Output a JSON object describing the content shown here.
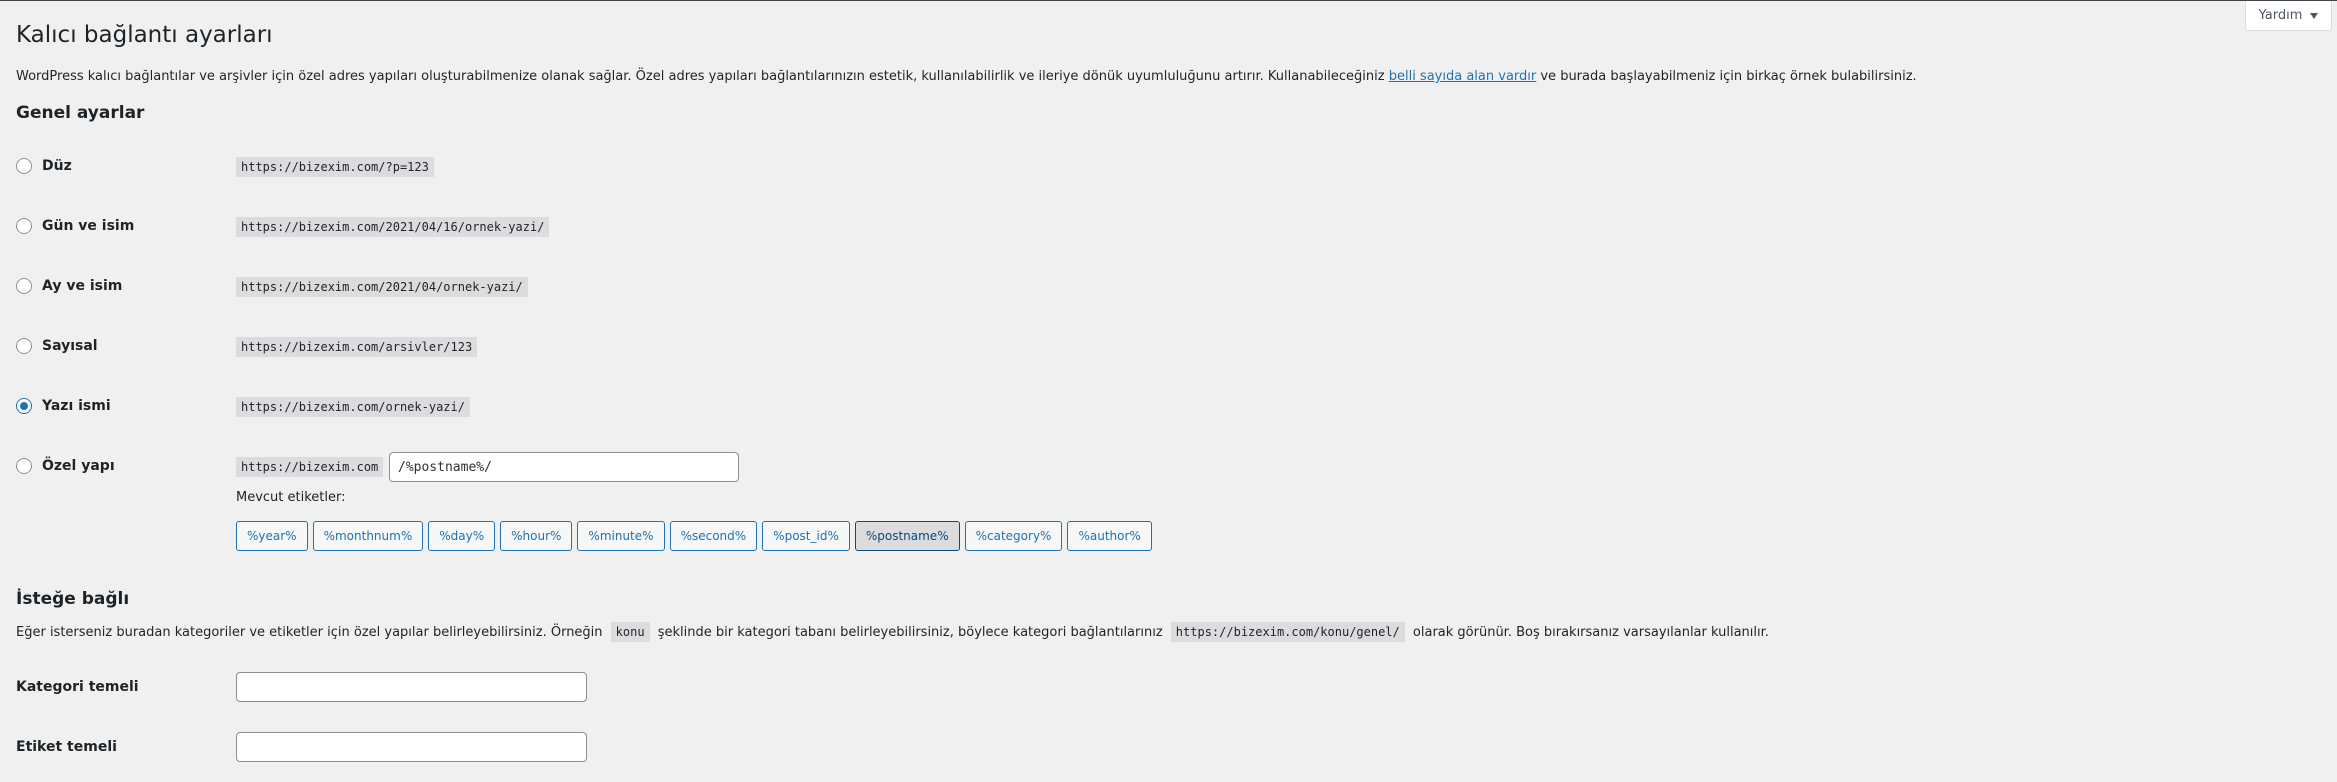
{
  "help": {
    "label": "Yardım"
  },
  "page": {
    "title": "Kalıcı bağlantı ayarları",
    "description_before": "WordPress kalıcı bağlantılar ve arşivler için özel adres yapıları oluşturabilmenize olanak sağlar. Özel adres yapıları bağlantılarınızın estetik, kullanılabilirlik ve ileriye dönük uyumluluğunu artırır. Kullanabileceğiniz ",
    "description_link": "belli sayıda alan vardır",
    "description_after": " ve burada başlayabilmeniz için birkaç örnek bulabilirsiniz."
  },
  "general": {
    "heading": "Genel ayarlar",
    "options": [
      {
        "label": "Düz",
        "example": "https://bizexim.com/?p=123",
        "checked": false
      },
      {
        "label": "Gün ve isim",
        "example": "https://bizexim.com/2021/04/16/ornek-yazi/",
        "checked": false
      },
      {
        "label": "Ay ve isim",
        "example": "https://bizexim.com/2021/04/ornek-yazi/",
        "checked": false
      },
      {
        "label": "Sayısal",
        "example": "https://bizexim.com/arsivler/123",
        "checked": false
      },
      {
        "label": "Yazı ismi",
        "example": "https://bizexim.com/ornek-yazi/",
        "checked": true
      },
      {
        "label": "Özel yapı",
        "example": "https://bizexim.com",
        "checked": false
      }
    ],
    "custom_value": "/%postname%/",
    "available_tags_label": "Mevcut etiketler:",
    "tags": [
      "%year%",
      "%monthnum%",
      "%day%",
      "%hour%",
      "%minute%",
      "%second%",
      "%post_id%",
      "%postname%",
      "%category%",
      "%author%"
    ],
    "active_tag": "%postname%"
  },
  "optional": {
    "heading": "İsteğe bağlı",
    "desc_1": "Eğer isterseniz buradan kategoriler ve etiketler için özel yapılar belirleyebilirsiniz. Örneğin",
    "desc_code_1": "konu",
    "desc_2": "şeklinde bir kategori tabanı belirleyebilirsiniz, böylece kategori bağlantılarınız",
    "desc_code_2": "https://bizexim.com/konu/genel/",
    "desc_3": "olarak görünür. Boş bırakırsanız varsayılanlar kullanılır.",
    "category_base_label": "Kategori temeli",
    "category_base_value": "",
    "tag_base_label": "Etiket temeli",
    "tag_base_value": ""
  },
  "colors": {
    "accent": "#2271b1",
    "background": "#f0f0f1",
    "text": "#1d2327"
  }
}
